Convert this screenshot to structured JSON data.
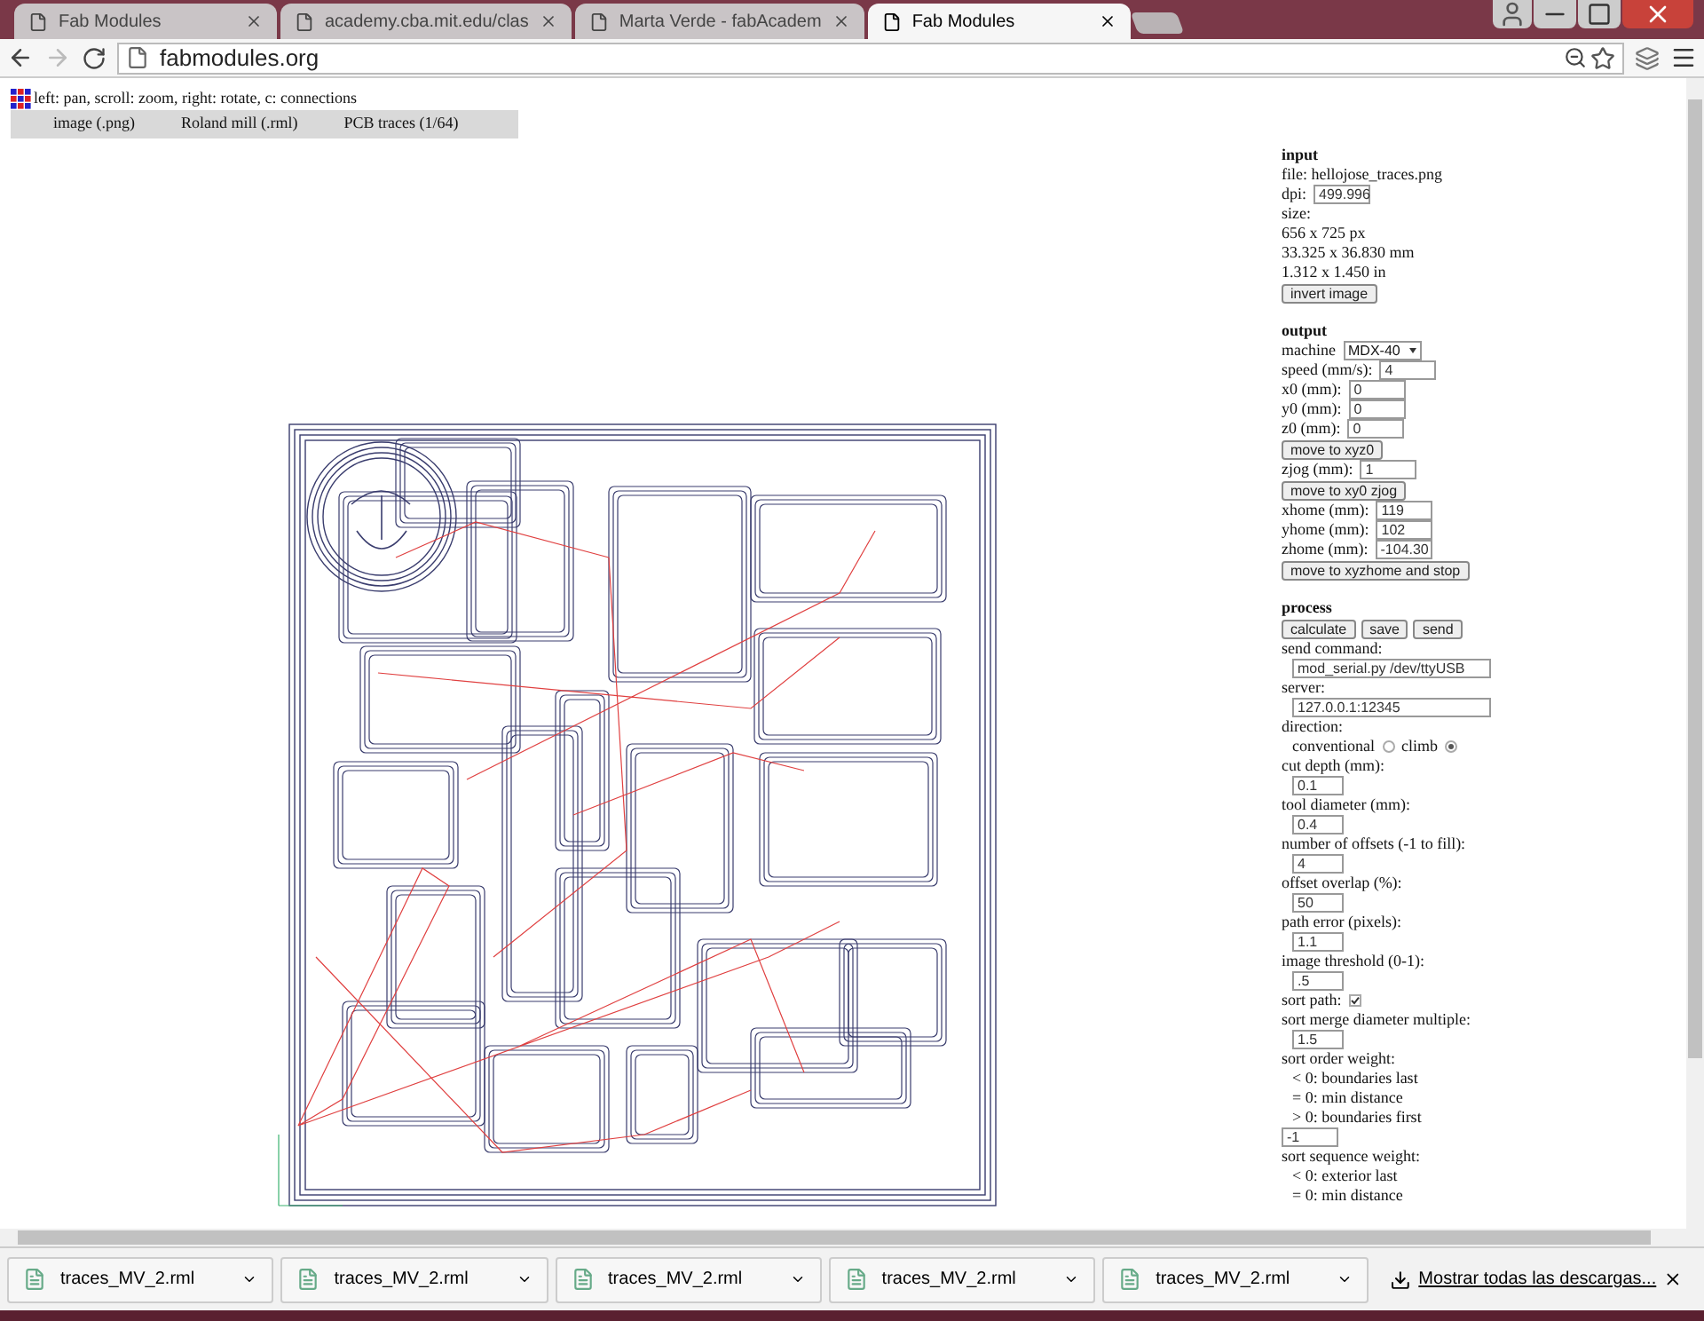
{
  "browser": {
    "tabs": [
      {
        "title": "Fab Modules",
        "selected": false
      },
      {
        "title": "academy.cba.mit.edu/clas",
        "selected": false
      },
      {
        "title": "Marta Verde - fabAcadem",
        "selected": false
      },
      {
        "title": "Fab Modules",
        "selected": true
      }
    ],
    "address": "fabmodules.org"
  },
  "page": {
    "hint": "left: pan, scroll: zoom, right: rotate, c: connections",
    "menu": [
      {
        "label": "image (.png)"
      },
      {
        "label": "Roland mill (.rml)"
      },
      {
        "label": "PCB traces (1/64)"
      }
    ],
    "panel": [
      {
        "title": "input",
        "rows": [
          {
            "kind": "text",
            "text": "file: hellojose_traces.png"
          },
          {
            "kind": "field",
            "label": "dpi:",
            "value": "499.996"
          },
          {
            "kind": "text",
            "text": "size:"
          },
          {
            "kind": "text",
            "text": "656 x 725 px"
          },
          {
            "kind": "text",
            "text": "33.325 x 36.830 mm"
          },
          {
            "kind": "text",
            "text": "1.312 x 1.450 in"
          },
          {
            "kind": "buttons",
            "buttons": [
              "invert image"
            ]
          }
        ]
      },
      {
        "title": "output",
        "rows": [
          {
            "kind": "select",
            "label": "machine",
            "value": "MDX-40"
          },
          {
            "kind": "field",
            "label": "speed (mm/s):",
            "value": "4"
          },
          {
            "kind": "field",
            "label": "x0 (mm):",
            "value": "0"
          },
          {
            "kind": "field",
            "label": "y0 (mm):",
            "value": "0"
          },
          {
            "kind": "field",
            "label": "z0 (mm):",
            "value": "0"
          },
          {
            "kind": "buttons",
            "buttons": [
              "move to xyz0"
            ]
          },
          {
            "kind": "field",
            "label": "zjog (mm):",
            "value": "1"
          },
          {
            "kind": "buttons",
            "buttons": [
              "move to xy0 zjog"
            ]
          },
          {
            "kind": "field",
            "label": "xhome (mm):",
            "value": "119"
          },
          {
            "kind": "field",
            "label": "yhome (mm):",
            "value": "102"
          },
          {
            "kind": "field",
            "label": "zhome (mm):",
            "value": "-104.30"
          },
          {
            "kind": "buttons",
            "buttons": [
              "move to xyzhome and stop"
            ]
          }
        ]
      },
      {
        "title": "process",
        "rows": [
          {
            "kind": "buttons",
            "buttons": [
              "calculate",
              "save",
              "send"
            ]
          },
          {
            "kind": "wide_field",
            "label": "send command:",
            "value": "mod_serial.py /dev/ttyUSB"
          },
          {
            "kind": "wide_field",
            "label": "server:",
            "value": "127.0.0.1:12345"
          },
          {
            "kind": "text",
            "text": "direction:"
          },
          {
            "kind": "radio",
            "options": [
              {
                "label": "conventional",
                "selected": false
              },
              {
                "label": "climb",
                "selected": true
              }
            ]
          },
          {
            "kind": "field_below",
            "label": "cut depth (mm):",
            "value": "0.1"
          },
          {
            "kind": "field_below",
            "label": "tool diameter (mm):",
            "value": "0.4"
          },
          {
            "kind": "field_below",
            "label": "number of offsets (-1 to fill):",
            "value": "4"
          },
          {
            "kind": "field_below",
            "label": "offset overlap (%):",
            "value": "50"
          },
          {
            "kind": "field_below",
            "label": "path error (pixels):",
            "value": "1.1"
          },
          {
            "kind": "field_below",
            "label": "image threshold (0-1):",
            "value": ".5"
          },
          {
            "kind": "check",
            "label": "sort path:",
            "checked": true
          },
          {
            "kind": "field_below",
            "label": "sort merge diameter multiple:",
            "value": "1.5"
          },
          {
            "kind": "text",
            "text": "sort order weight:"
          },
          {
            "kind": "indent",
            "text": "< 0: boundaries last"
          },
          {
            "kind": "indent",
            "text": "= 0: min distance"
          },
          {
            "kind": "indent",
            "text": "> 0: boundaries first"
          },
          {
            "kind": "field",
            "label": "",
            "value": "-1"
          },
          {
            "kind": "text",
            "text": "sort sequence weight:"
          },
          {
            "kind": "indent",
            "text": "< 0: exterior last"
          },
          {
            "kind": "indent",
            "text": "= 0: min distance"
          }
        ]
      }
    ]
  },
  "downloads": {
    "items": [
      {
        "name": "traces_MV_2.rml"
      },
      {
        "name": "traces_MV_2.rml"
      },
      {
        "name": "traces_MV_2.rml"
      },
      {
        "name": "traces_MV_2.rml"
      },
      {
        "name": "traces_MV_2.rml"
      }
    ],
    "show_all": "Mostrar todas las descargas..."
  }
}
